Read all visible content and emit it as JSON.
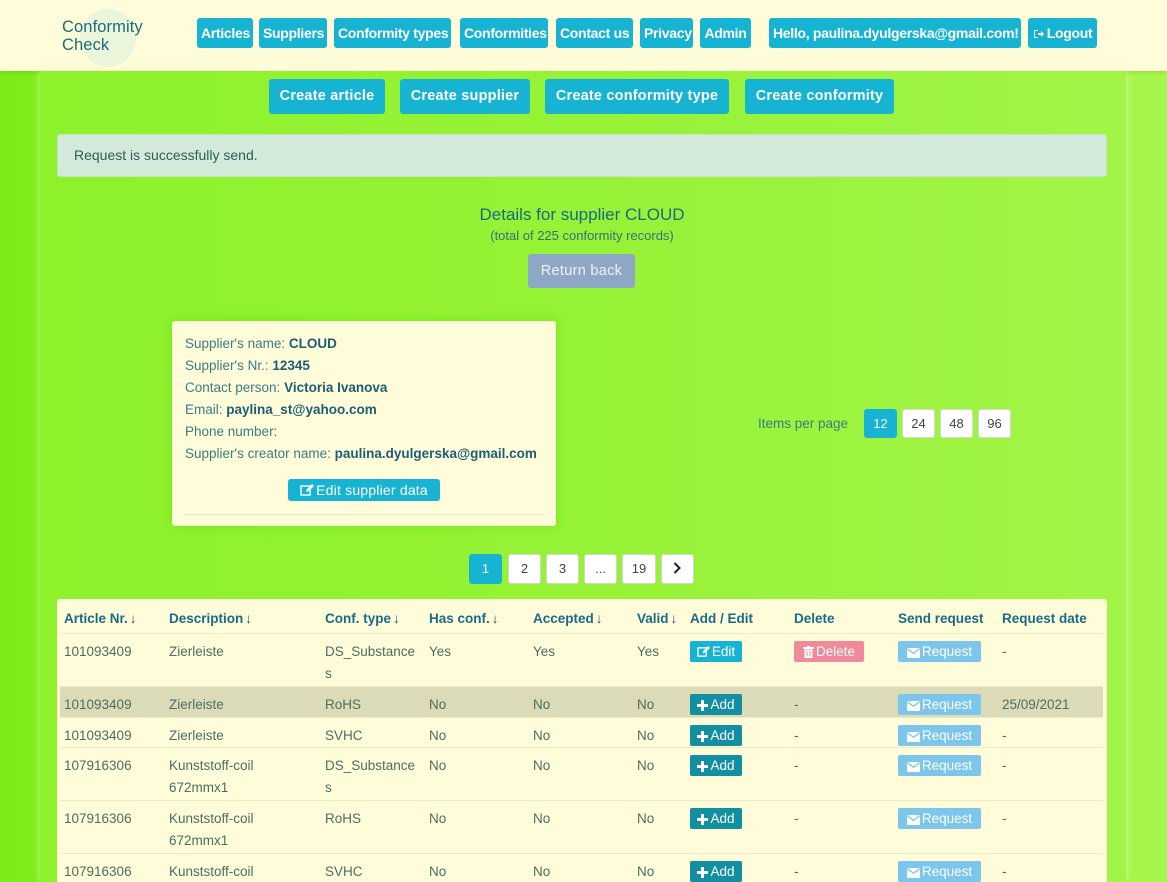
{
  "brand": {
    "line1": "Conformity",
    "line2": "Check"
  },
  "nav": {
    "articles": "Articles",
    "suppliers": "Suppliers",
    "conformity_types": "Conformity types",
    "conformities": "Conformities",
    "contact": "Contact us",
    "privacy": "Privacy",
    "admin": "Admin",
    "greeting": "Hello, paulina.dyulgerska@gmail.com!",
    "logout": "Logout"
  },
  "create": {
    "article": "Create article",
    "supplier": "Create supplier",
    "conformity_type": "Create conformity type",
    "conformity": "Create conformity"
  },
  "alert": "Request is successfully send.",
  "details": {
    "title": "Details for supplier CLOUD",
    "subtitle": "(total of 225 conformity records)",
    "return_label": "Return back"
  },
  "supplier": {
    "name_label": "Supplier's name:",
    "name": "CLOUD",
    "nr_label": "Supplier's Nr.:",
    "nr": "12345",
    "contact_label": "Contact person:",
    "contact": "Victoria Ivanova",
    "email_label": "Email:",
    "email": "paylina_st@yahoo.com",
    "phone_label": "Phone number:",
    "phone": "",
    "creator_label": "Supplier's creator name:",
    "creator": "paulina.dyulgerska@gmail.com",
    "edit_label": "Edit supplier data"
  },
  "items_per_page": {
    "label": "Items per page",
    "options": [
      "12",
      "24",
      "48",
      "96"
    ],
    "selected": "12"
  },
  "pagination": {
    "pages": [
      "1",
      "2",
      "3",
      "...",
      "19"
    ],
    "current": "1"
  },
  "table": {
    "headers": {
      "article_nr": "Article Nr.",
      "description": "Description",
      "conf_type": "Conf. type",
      "has_conf": "Has conf.",
      "accepted": "Accepted",
      "valid": "Valid",
      "add_edit": "Add / Edit",
      "delete": "Delete",
      "send_request": "Send request",
      "request_date": "Request date"
    },
    "rows": [
      {
        "article_nr": "101093409",
        "description": "Zierleiste",
        "conf_type_1": "DS_Substance",
        "conf_type_2": "s",
        "has_conf": "Yes",
        "accepted": "Yes",
        "valid": "Yes",
        "action": "Edit",
        "delete": "Delete",
        "request": "Request",
        "request_date": "-"
      },
      {
        "article_nr": "101093409",
        "description": "Zierleiste",
        "conf_type_1": "RoHS",
        "conf_type_2": "",
        "has_conf": "No",
        "accepted": "No",
        "valid": "No",
        "action": "Add",
        "delete": "-",
        "request": "Request",
        "request_date": "25/09/2021"
      },
      {
        "article_nr": "101093409",
        "description": "Zierleiste",
        "conf_type_1": "SVHC",
        "conf_type_2": "",
        "has_conf": "No",
        "accepted": "No",
        "valid": "No",
        "action": "Add",
        "delete": "-",
        "request": "Request",
        "request_date": "-"
      },
      {
        "article_nr": "107916306",
        "description_1": "Kunststoff-coil",
        "description_2": "672mmx1",
        "conf_type_1": "DS_Substance",
        "conf_type_2": "s",
        "has_conf": "No",
        "accepted": "No",
        "valid": "No",
        "action": "Add",
        "delete": "-",
        "request": "Request",
        "request_date": "-"
      },
      {
        "article_nr": "107916306",
        "description_1": "Kunststoff-coil",
        "description_2": "672mmx1",
        "conf_type_1": "RoHS",
        "conf_type_2": "",
        "has_conf": "No",
        "accepted": "No",
        "valid": "No",
        "action": "Add",
        "delete": "-",
        "request": "Request",
        "request_date": "-"
      },
      {
        "article_nr": "107916306",
        "description_1": "Kunststoff-coil",
        "description_2": "",
        "conf_type_1": "SVHC",
        "conf_type_2": "",
        "has_conf": "No",
        "accepted": "No",
        "valid": "No",
        "action": "Add",
        "delete": "-",
        "request": "Request",
        "request_date": "-"
      }
    ]
  },
  "colors": {
    "accent": "#17b3d2",
    "add_button": "#128fa0",
    "delete_button": "#f08a9a",
    "request_button": "#7cc6ec",
    "navbar_bg": "#fefcd9",
    "page_bg": "#8ef02a"
  },
  "icons": {
    "edit": "edit-icon",
    "delete": "trash-icon",
    "add": "plus-icon",
    "request": "envelope-icon",
    "logout": "logout-icon",
    "sort": "sort-down-arrow-icon",
    "next": "chevron-right-icon"
  }
}
